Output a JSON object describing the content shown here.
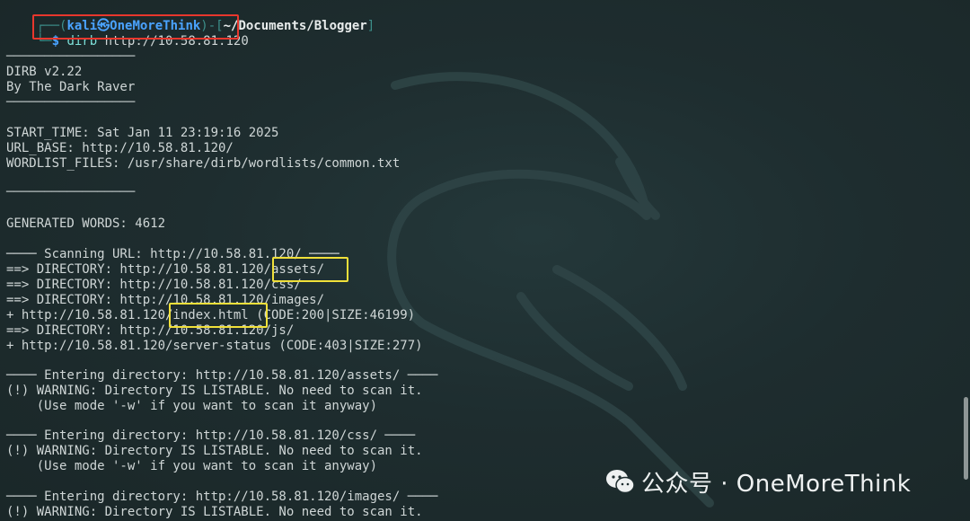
{
  "prompt": {
    "frame_top_left": "┌──(",
    "user_host": "kali㉿OneMoreThink",
    "frame_mid": ")-[",
    "path": "~/Documents/Blogger",
    "frame_end": "]",
    "frame_bottom": "└─",
    "dollar": "$",
    "command_program": "dirb",
    "command_args": " http://10.58.81.120"
  },
  "output_lines": [
    {
      "text": "─────────────────",
      "kind": "rule"
    },
    {
      "text": "DIRB v2.22",
      "kind": "text"
    },
    {
      "text": "By The Dark Raver",
      "kind": "text"
    },
    {
      "text": "─────────────────",
      "kind": "rule"
    },
    {
      "text": "START_TIME: Sat Jan 11 23:19:16 2025",
      "kind": "text"
    },
    {
      "text": "URL_BASE: http://10.58.81.120/",
      "kind": "text"
    },
    {
      "text": "WORDLIST_FILES: /usr/share/dirb/wordlists/common.txt",
      "kind": "text"
    },
    {
      "text": "─────────────────",
      "kind": "rule"
    },
    {
      "text": "GENERATED WORDS: 4612",
      "kind": "text"
    },
    {
      "text": "──── Scanning URL: http://10.58.81.120/ ────",
      "kind": "text"
    },
    {
      "text": "==> DIRECTORY: http://10.58.81.120/assets/",
      "kind": "text"
    },
    {
      "text": "==> DIRECTORY: http://10.58.81.120/css/",
      "kind": "text"
    },
    {
      "text": "==> DIRECTORY: http://10.58.81.120/images/",
      "kind": "text"
    },
    {
      "text": "+ http://10.58.81.120/index.html (CODE:200|SIZE:46199)",
      "kind": "text"
    },
    {
      "text": "==> DIRECTORY: http://10.58.81.120/js/",
      "kind": "text"
    },
    {
      "text": "+ http://10.58.81.120/server-status (CODE:403|SIZE:277)",
      "kind": "text"
    },
    {
      "text": "──── Entering directory: http://10.58.81.120/assets/ ────",
      "kind": "text"
    },
    {
      "text": "(!) WARNING: Directory IS LISTABLE. No need to scan it.",
      "kind": "text"
    },
    {
      "text": "    (Use mode '-w' if you want to scan it anyway)",
      "kind": "text"
    },
    {
      "text": "──── Entering directory: http://10.58.81.120/css/ ────",
      "kind": "text"
    },
    {
      "text": "(!) WARNING: Directory IS LISTABLE. No need to scan it.",
      "kind": "text"
    },
    {
      "text": "    (Use mode '-w' if you want to scan it anyway)",
      "kind": "text"
    },
    {
      "text": "──── Entering directory: http://10.58.81.120/images/ ────",
      "kind": "text"
    },
    {
      "text": "(!) WARNING: Directory IS LISTABLE. No need to scan it.",
      "kind": "text"
    }
  ],
  "watermark": {
    "text": "公众号 · OneMoreThink",
    "icon": "wechat-icon"
  },
  "colors": {
    "background": "#1e2d2f",
    "text": "#cfd6d6",
    "highlight_red": "#e8372d",
    "highlight_yellow": "#f0e03a",
    "prompt_blue": "#4aa3ff",
    "prompt_frame": "#3c8f8a"
  }
}
